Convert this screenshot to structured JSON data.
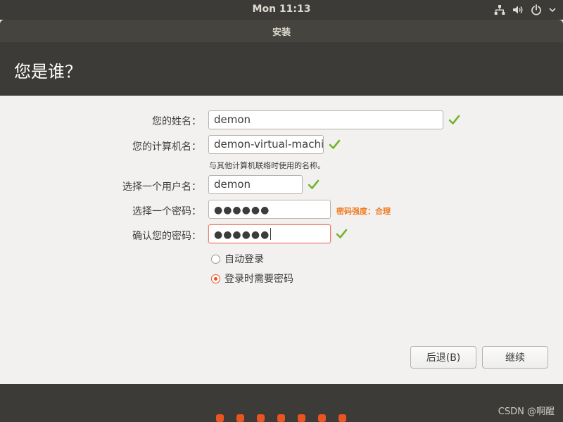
{
  "top_panel": {
    "clock": "Mon 11:13",
    "icons": [
      "network-icon",
      "volume-icon",
      "power-icon",
      "chevron-down-icon"
    ]
  },
  "window": {
    "title": "安装"
  },
  "header": {
    "heading": "您是谁？"
  },
  "form": {
    "name": {
      "label": "您的姓名：",
      "value": "demon",
      "valid": true
    },
    "computer_name": {
      "label": "您的计算机名：",
      "value": "demon-virtual-machine",
      "valid": true,
      "hint": "与其他计算机联络时使用的名称。"
    },
    "username": {
      "label": "选择一个用户名：",
      "value": "demon",
      "valid": true
    },
    "password": {
      "label": "选择一个密码：",
      "value": "●●●●●●",
      "strength": "密码强度：合理"
    },
    "confirm_password": {
      "label": "确认您的密码：",
      "value": "●●●●●●",
      "valid": true
    },
    "login_options": [
      {
        "label": "自动登录",
        "selected": false
      },
      {
        "label": "登录时需要密码",
        "selected": true
      }
    ]
  },
  "buttons": {
    "back": "后退(B)",
    "continue": "继续"
  },
  "progress": {
    "total_steps": 7
  },
  "watermark": "CSDN @啊醒",
  "colors": {
    "accent": "#e95420",
    "check": "#73b52a",
    "panel": "#3c3b37",
    "background": "#f2f1f0",
    "strength_text": "#f07a20"
  }
}
